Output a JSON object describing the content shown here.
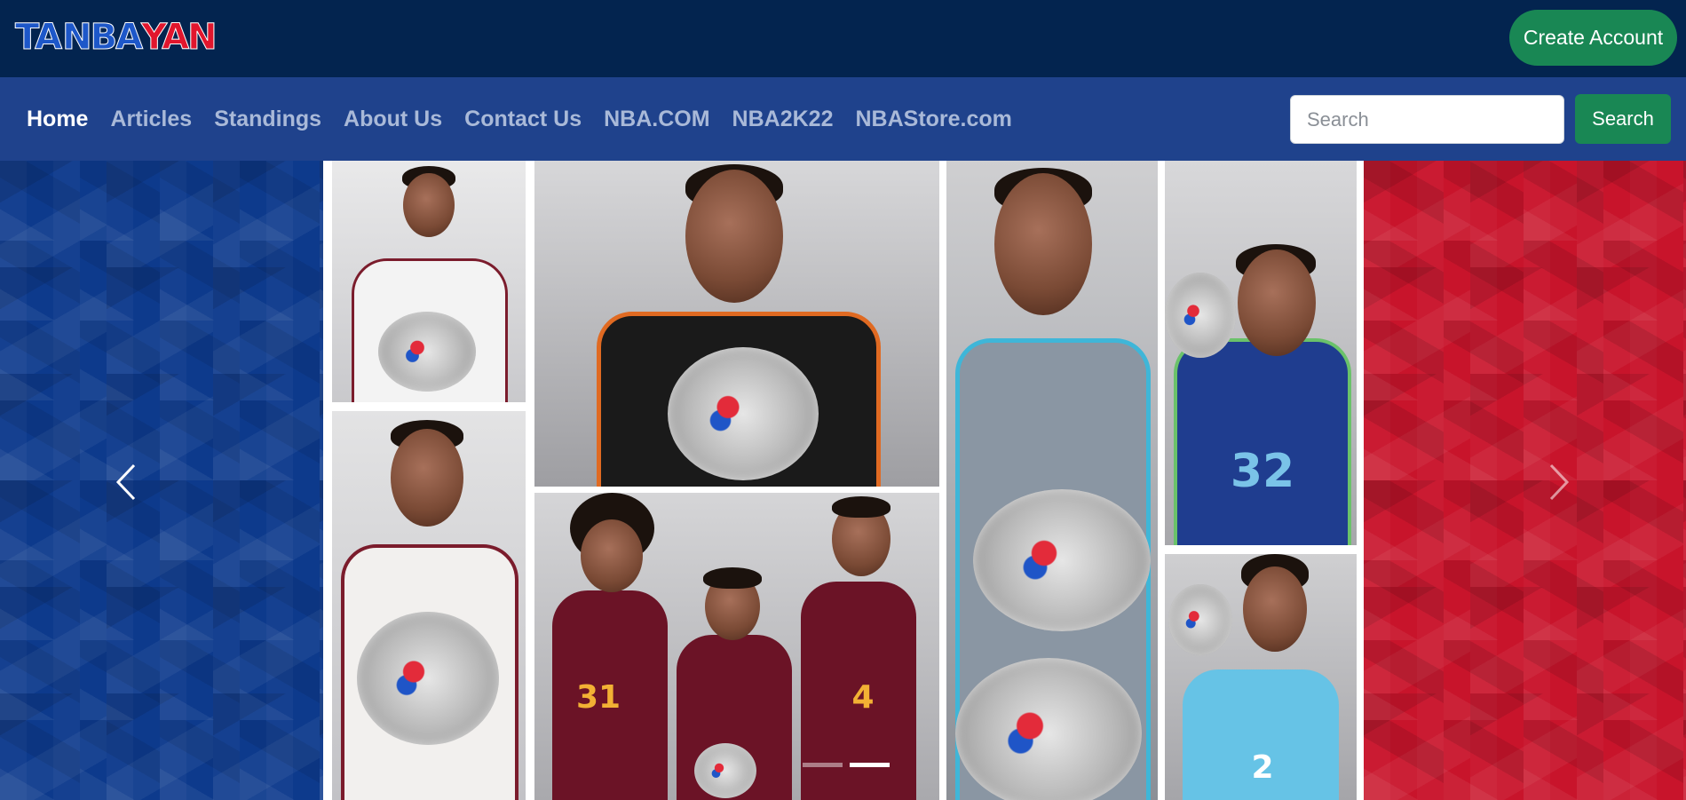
{
  "header": {
    "logo": {
      "part1": "TA",
      "part2": "NBA",
      "part3": "YAN"
    },
    "create_account_label": "Create Account"
  },
  "nav": {
    "links": [
      {
        "label": "Home",
        "active": true
      },
      {
        "label": "Articles",
        "active": false
      },
      {
        "label": "Standings",
        "active": false
      },
      {
        "label": "About Us",
        "active": false
      },
      {
        "label": "Contact Us",
        "active": false
      },
      {
        "label": "NBA.COM",
        "active": false
      },
      {
        "label": "NBA2K22",
        "active": false
      },
      {
        "label": "NBAStore.com",
        "active": false
      }
    ],
    "search": {
      "placeholder": "Search",
      "value": "",
      "button_label": "Search"
    }
  },
  "carousel": {
    "slide_count": 2,
    "active_index": 1,
    "jersey_numbers": [
      "31",
      "4",
      "32",
      "2"
    ],
    "colors": {
      "left_panel": "#0d3a8c",
      "right_panel": "#c8142b",
      "accent_green": "#198754",
      "topbar": "#03244f",
      "navbar": "#1f428c"
    },
    "prev_icon": "chevron-left-icon",
    "next_icon": "chevron-right-icon"
  }
}
